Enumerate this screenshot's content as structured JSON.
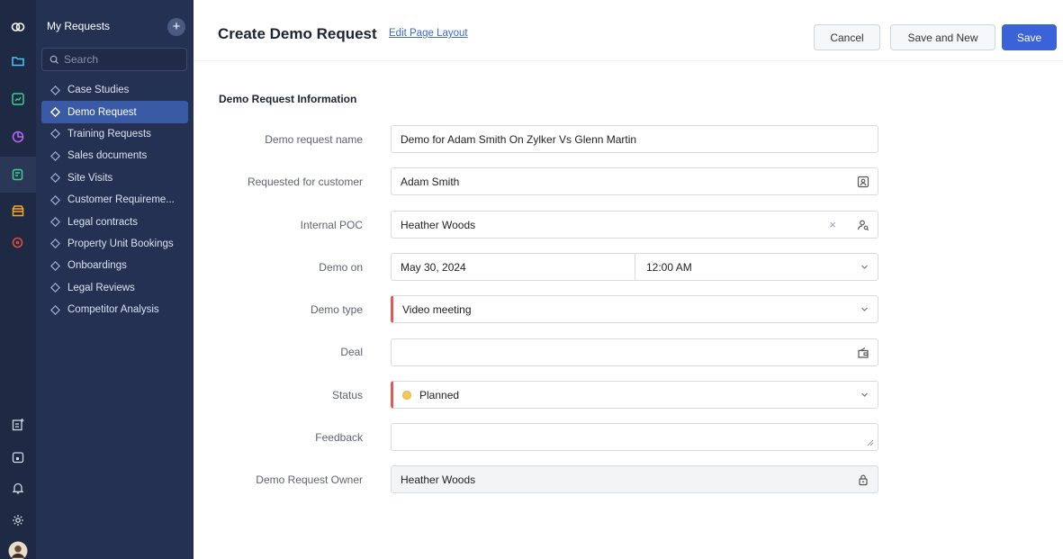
{
  "sidebar": {
    "title": "My Requests",
    "add_label": "+",
    "search_placeholder": "Search",
    "items": [
      {
        "label": "Case Studies"
      },
      {
        "label": "Demo Request"
      },
      {
        "label": "Training Requests"
      },
      {
        "label": "Sales documents"
      },
      {
        "label": "Site Visits"
      },
      {
        "label": "Customer Requireme..."
      },
      {
        "label": "Legal contracts"
      },
      {
        "label": "Property Unit Bookings"
      },
      {
        "label": "Onboardings"
      },
      {
        "label": "Legal Reviews"
      },
      {
        "label": "Competitor Analysis"
      }
    ]
  },
  "header": {
    "title": "Create Demo Request",
    "edit_link": "Edit Page Layout",
    "cancel": "Cancel",
    "save_and_new": "Save and New",
    "save": "Save"
  },
  "form": {
    "section_title": "Demo Request Information",
    "demo_request_name": {
      "label": "Demo request name",
      "value": "Demo for Adam Smith On Zylker Vs Glenn Martin"
    },
    "requested_for_customer": {
      "label": "Requested for customer",
      "value": "Adam Smith"
    },
    "internal_poc": {
      "label": "Internal POC",
      "value": "Heather Woods",
      "clear": "×"
    },
    "demo_on": {
      "label": "Demo on",
      "date": "May 30, 2024",
      "time": "12:00 AM"
    },
    "demo_type": {
      "label": "Demo type",
      "value": "Video meeting"
    },
    "deal": {
      "label": "Deal",
      "value": ""
    },
    "status": {
      "label": "Status",
      "value": "Planned"
    },
    "feedback": {
      "label": "Feedback",
      "value": ""
    },
    "owner": {
      "label": "Demo Request Owner",
      "value": "Heather Woods"
    }
  },
  "colors": {
    "rail": "#1e2a44",
    "sidebar": "#243152",
    "active_item": "#3a5aa5",
    "primary": "#3a63d9",
    "mandatory": "#e05a5a",
    "status_planned": "#f2c75c"
  },
  "icons": {
    "rail": [
      "zoho-logo-icon",
      "folder-icon",
      "chart-icon",
      "pie-icon",
      "form-icon",
      "store-icon",
      "search-circle-icon",
      "new-entry-icon",
      "calendar-icon",
      "bell-icon",
      "settings-icon",
      "avatar"
    ]
  }
}
